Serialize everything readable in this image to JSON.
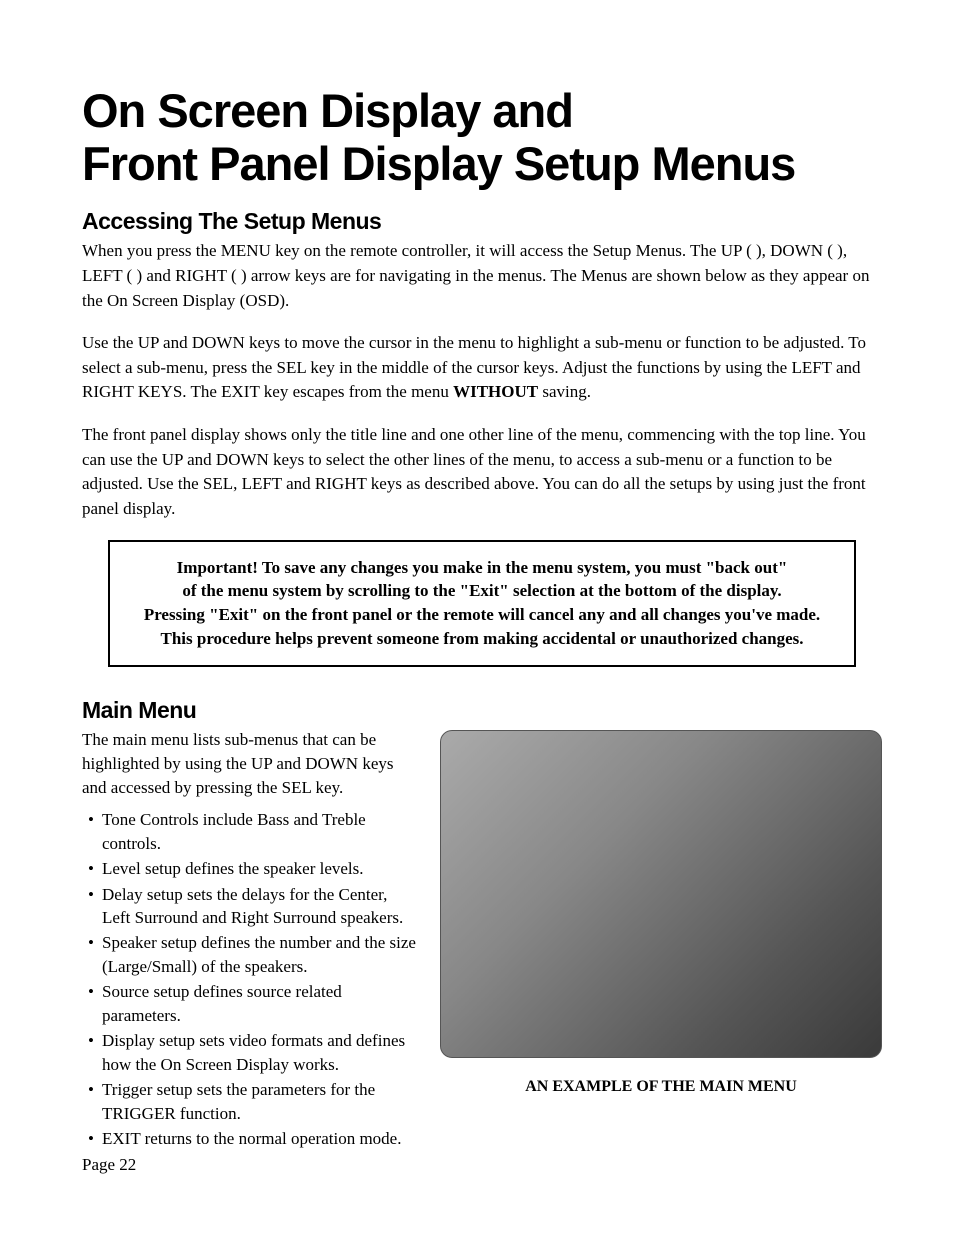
{
  "title_line1": "On Screen Display and",
  "title_line2": "Front Panel Display Setup Menus",
  "section1": {
    "heading": "Accessing The Setup Menus",
    "para1_a": "When you press the MENU key on the remote controller, it will access the Setup Menus. The UP (    ), DOWN (    ), LEFT (     ) and RIGHT (     ) arrow keys are for navigating in the menus. The Menus are shown below as they appear on the On Screen Display (OSD).",
    "para2_a": "Use the UP and DOWN keys to move the cursor in the menu to highlight a sub-menu or function to be adjusted. To select a sub-menu, press the SEL  key in the middle of the cursor keys. Adjust the functions by using the LEFT and RIGHT KEYS. The EXIT key escapes from the menu ",
    "para2_bold": "WITHOUT",
    "para2_b": " saving.",
    "para3": "The front panel display shows only the title line and one other line of the menu, commencing with the top line. You can use the UP and DOWN keys to select the other lines of the menu, to access a sub-menu or a function to be adjusted. Use the SEL, LEFT and RIGHT keys as described above. You can do all the setups by using just the front panel display."
  },
  "callout": {
    "line1": "Important! To save any changes you make in the menu system, you must \"back out\"",
    "line2": "of the menu system by scrolling to the \"Exit\" selection at the bottom of the display.",
    "line3": "Pressing \"Exit\" on the front panel or the remote will cancel any and all changes you've made.",
    "line4": "This procedure helps prevent someone from making accidental or unauthorized changes."
  },
  "section2": {
    "heading": "Main Menu",
    "intro": "The main menu lists sub-menus that can be highlighted by using the UP and DOWN keys and accessed by pressing the SEL key.",
    "bullets": [
      "Tone Controls include Bass and Treble controls.",
      "Level setup defines the speaker levels.",
      "Delay setup sets the delays for the Center, Left Surround and Right Surround speakers.",
      "Speaker setup defines the number and the size (Large/Small) of the speakers.",
      "Source setup defines source related parameters.",
      "Display setup sets video formats and defines how the On Screen Display works.",
      "Trigger setup sets the parameters for the TRIGGER function.",
      "EXIT returns to the normal operation mode."
    ],
    "caption": "AN EXAMPLE OF THE MAIN MENU"
  },
  "page_number": "Page 22"
}
